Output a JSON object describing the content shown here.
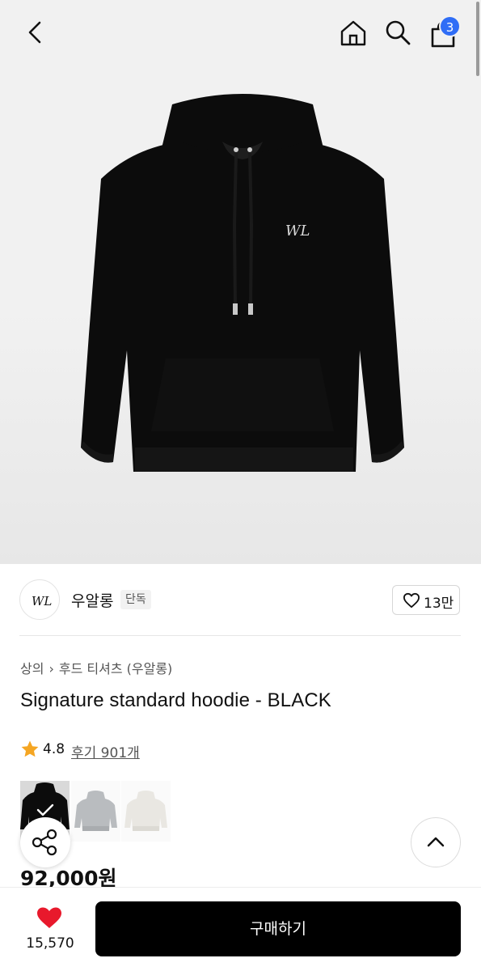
{
  "header": {
    "cart_count": "3",
    "icons": [
      "chevron-left-icon",
      "home-icon",
      "search-icon",
      "shopping-bag-icon"
    ]
  },
  "product": {
    "image_alt": "hoodie-image",
    "brand": {
      "logo_text": "WL",
      "name": "우알롱",
      "tag": "단독"
    },
    "likes": "13만",
    "breadcrumb": [
      "상의",
      "후드 티셔츠 (우알롱)"
    ],
    "title": "Signature standard hoodie - BLACK",
    "rating": "4.8",
    "review_link": "후기 901개",
    "swatches": [
      {
        "color": "#0c0c0c",
        "selected": true
      },
      {
        "color": "#b9bcbf",
        "selected": false
      },
      {
        "color": "#e9e7e2",
        "selected": false
      }
    ],
    "price": "92,000원"
  },
  "bottom_bar": {
    "wish_count": "15,570",
    "buy_label": "구매하기"
  },
  "colors": {
    "accent_blue": "#2f6df6",
    "heart_red": "#e8192c",
    "star_orange": "#f5a623",
    "primary_button": "#000000"
  }
}
